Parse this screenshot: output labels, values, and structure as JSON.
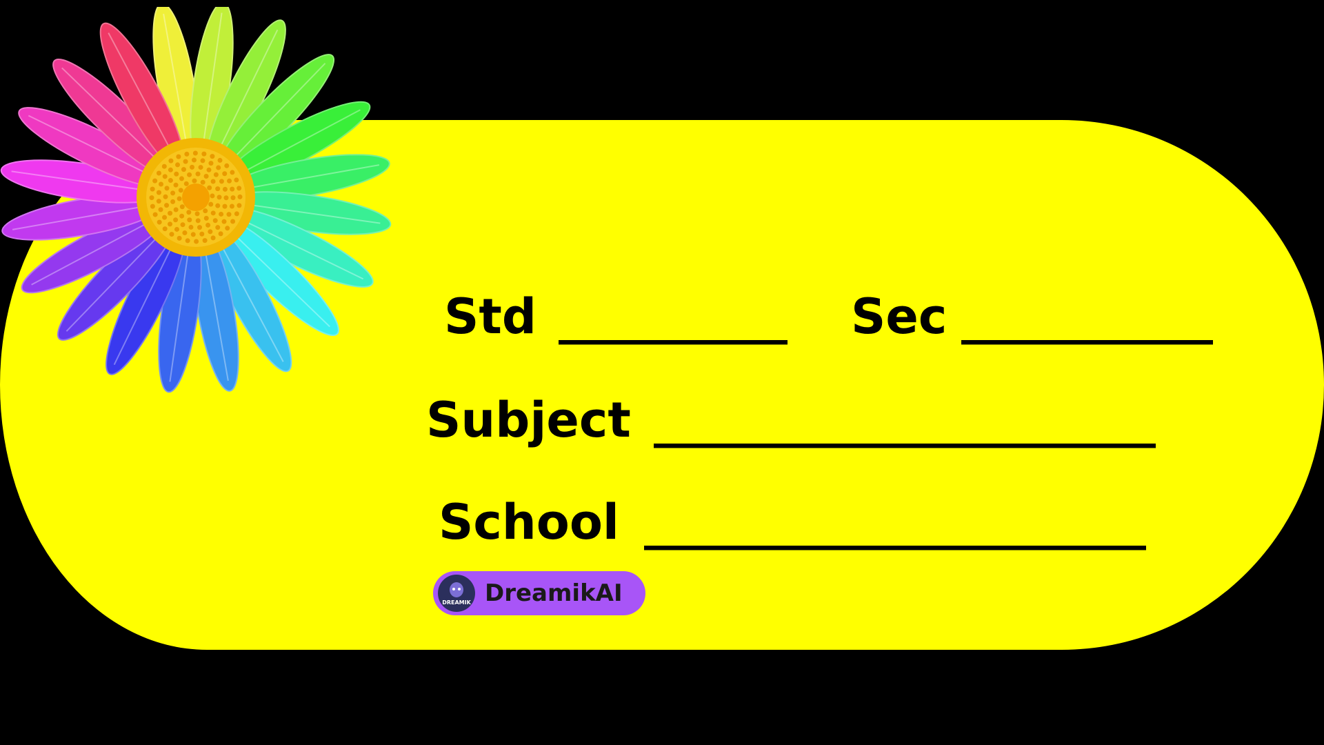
{
  "colors": {
    "background": "#000000",
    "label_fill": "#FFFF00",
    "text": "#000000",
    "badge_bg": "#A855F7"
  },
  "icons": [
    "rainbow-flower-icon",
    "dreamik-logo-icon"
  ],
  "label": {
    "std": {
      "label": "Std",
      "blank": "__________"
    },
    "sec": {
      "label": "Sec",
      "blank": "___________"
    },
    "subject": {
      "label": "Subject",
      "blank": "______________________"
    },
    "school": {
      "label": "School",
      "blank": "______________________"
    }
  },
  "badge": {
    "logo_text": "DREAMIK",
    "text": "DreamikAI"
  }
}
